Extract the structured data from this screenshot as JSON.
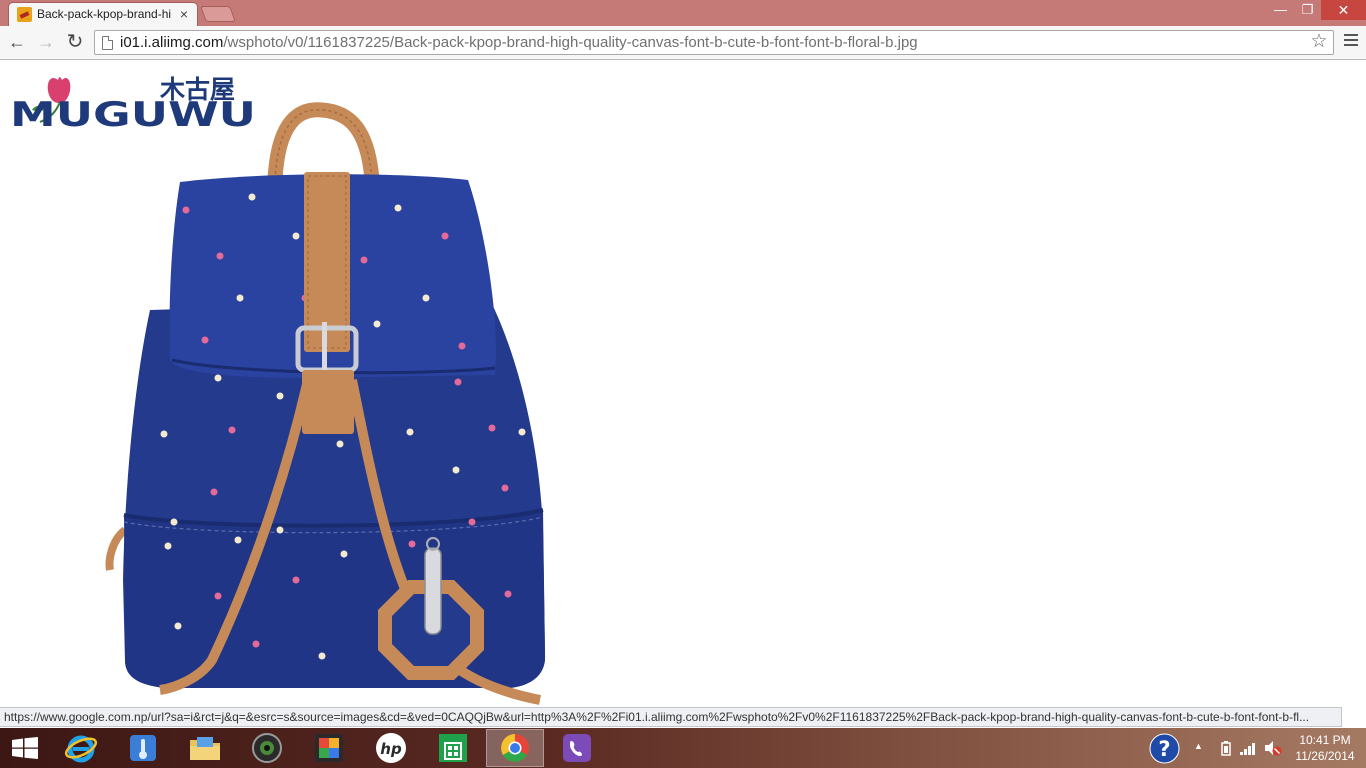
{
  "browser": {
    "tab": {
      "title": "Back-pack-kpop-brand-hi",
      "close_glyph": "×"
    },
    "window_controls": {
      "minimize": "—",
      "restore": "❐",
      "close": "✕"
    },
    "toolbar": {
      "back_glyph": "←",
      "forward_glyph": "→",
      "reload_glyph": "↻",
      "url_host": "i01.i.aliimg.com",
      "url_path": "/wsphoto/v0/1161837225/Back-pack-kpop-brand-high-quality-canvas-font-b-cute-b-font-font-b-floral-b.jpg",
      "star_glyph": "☆"
    },
    "status_bar": {
      "text": "https://www.google.com.np/url?sa=i&rct=j&q=&esrc=s&source=images&cd=&ved=0CAQQjBw&url=http%3A%2F%2Fi01.i.aliimg.com%2Fwsphoto%2Fv0%2F1161837225%2FBack-pack-kpop-brand-high-quality-canvas-font-b-cute-b-font-font-b-fl..."
    }
  },
  "image": {
    "brand_name": "MUGUWU",
    "brand_chinese": "木古屋",
    "colors": {
      "canvas_blue": "#243a8c",
      "leather_tan": "#c68a58",
      "logo_navy": "#1f3a7a",
      "logo_pink": "#d9406e"
    }
  },
  "taskbar": {
    "apps": [
      {
        "name": "internet-explorer",
        "icon": "ie-icon"
      },
      {
        "name": "control-panel",
        "icon": "thermometer-icon"
      },
      {
        "name": "file-explorer",
        "icon": "folder-icon"
      },
      {
        "name": "webcam",
        "icon": "camera-icon"
      },
      {
        "name": "photo-app",
        "icon": "puzzle-icon"
      },
      {
        "name": "hp",
        "icon": "hp-icon"
      },
      {
        "name": "store",
        "icon": "store-icon"
      },
      {
        "name": "chrome",
        "icon": "chrome-icon",
        "active": true
      },
      {
        "name": "viber",
        "icon": "viber-icon"
      }
    ],
    "tray": {
      "help": "?",
      "show_hidden": "▲"
    },
    "clock": {
      "time": "10:41 PM",
      "date": "11/26/2014"
    }
  }
}
